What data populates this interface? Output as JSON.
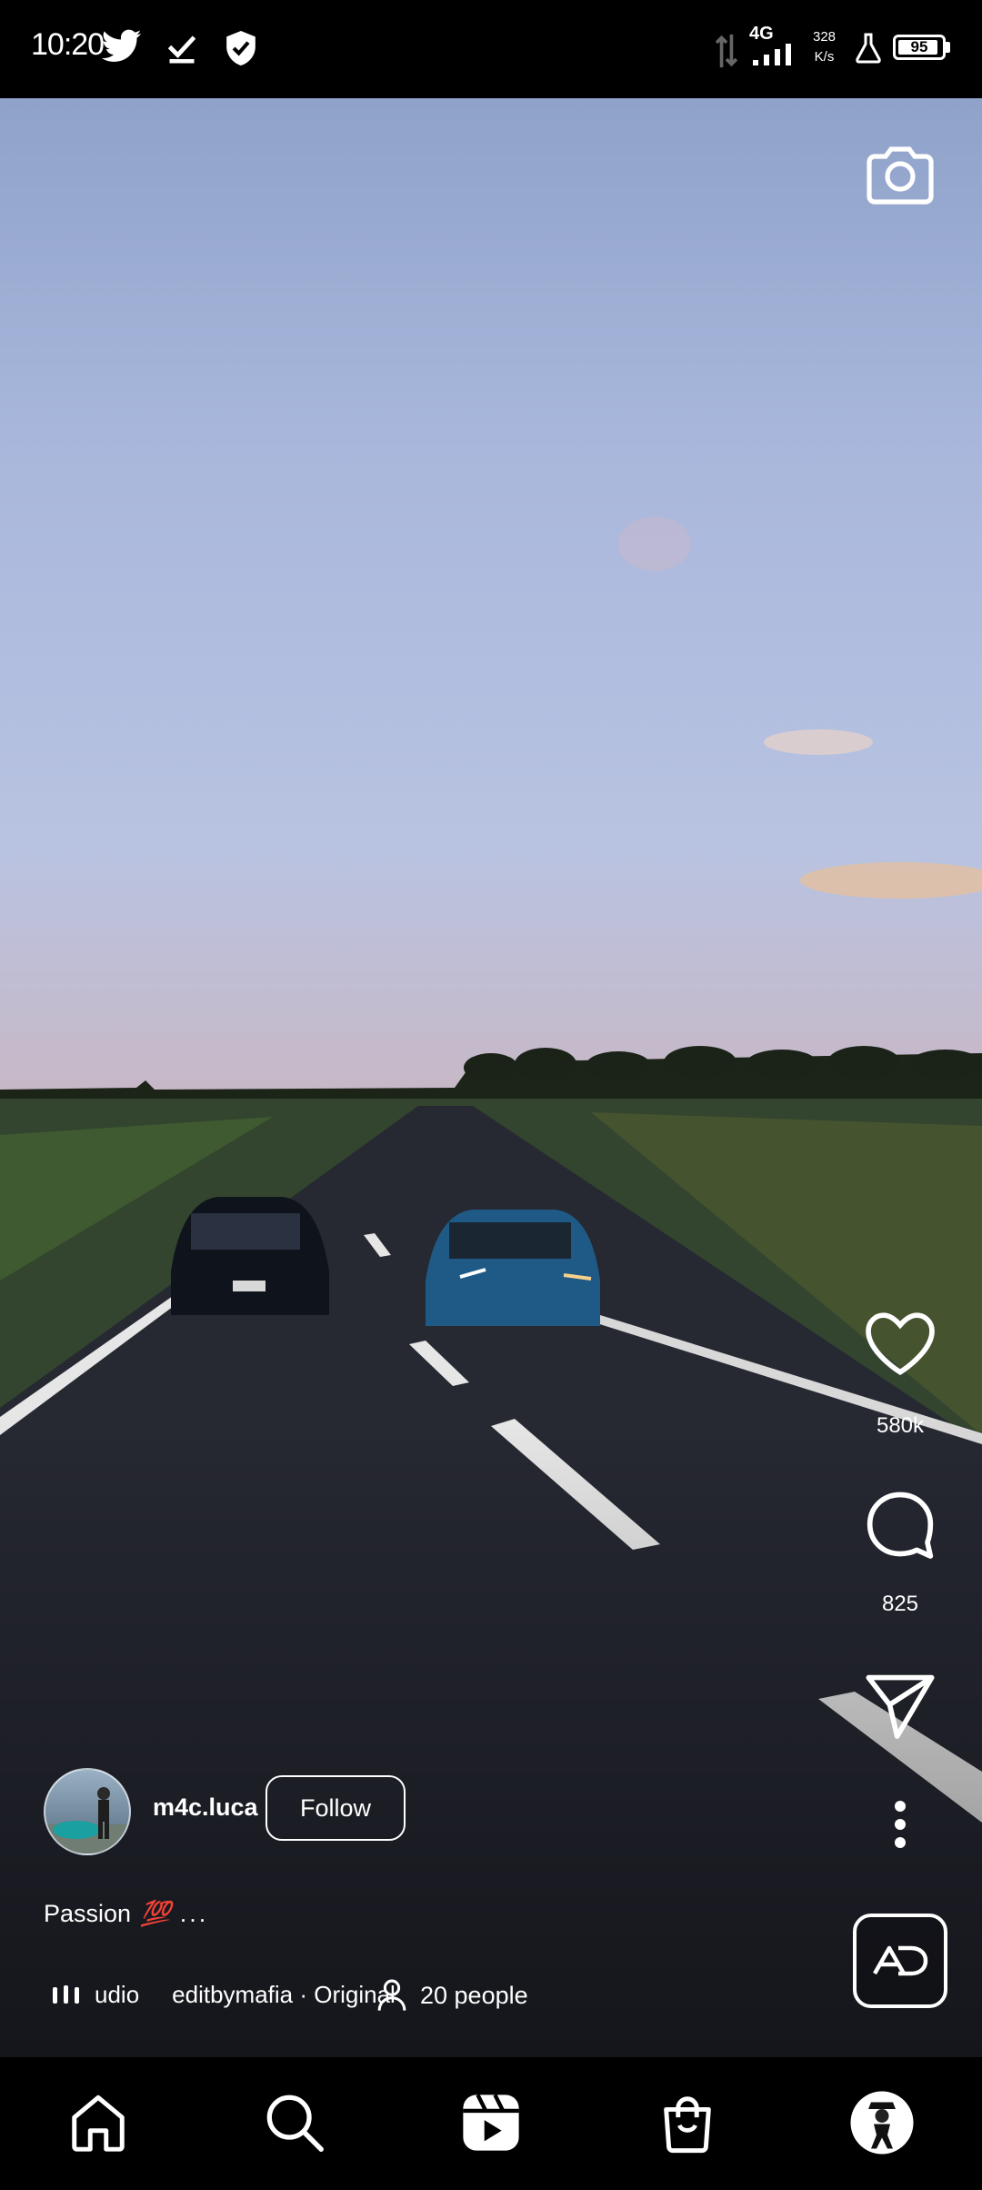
{
  "status_bar": {
    "time": "10:20",
    "network_type": "4G",
    "speed_value": "328",
    "speed_unit": "K/s",
    "battery": "95",
    "icons": [
      "twitter-icon",
      "download-done-icon",
      "shield-icon",
      "data-arrows-icon",
      "signal-icon",
      "flask-icon",
      "battery-icon"
    ]
  },
  "reel": {
    "like_count": "580k",
    "comment_count": "825",
    "author": {
      "username": "m4c.luca",
      "follow_label": "Follow"
    },
    "caption": {
      "text": "Passion",
      "emoji": "💯",
      "more": "..."
    },
    "audio": {
      "label": "udio",
      "source": "editbymafia · Original"
    },
    "people": "20 people",
    "ad_badge": "AD"
  },
  "nav": [
    "home-icon",
    "search-icon",
    "reels-icon",
    "shop-icon",
    "profile-avatar"
  ],
  "colors": {
    "background": "#000000",
    "text": "#ffffff",
    "emoji_red": "#e23a3a"
  }
}
